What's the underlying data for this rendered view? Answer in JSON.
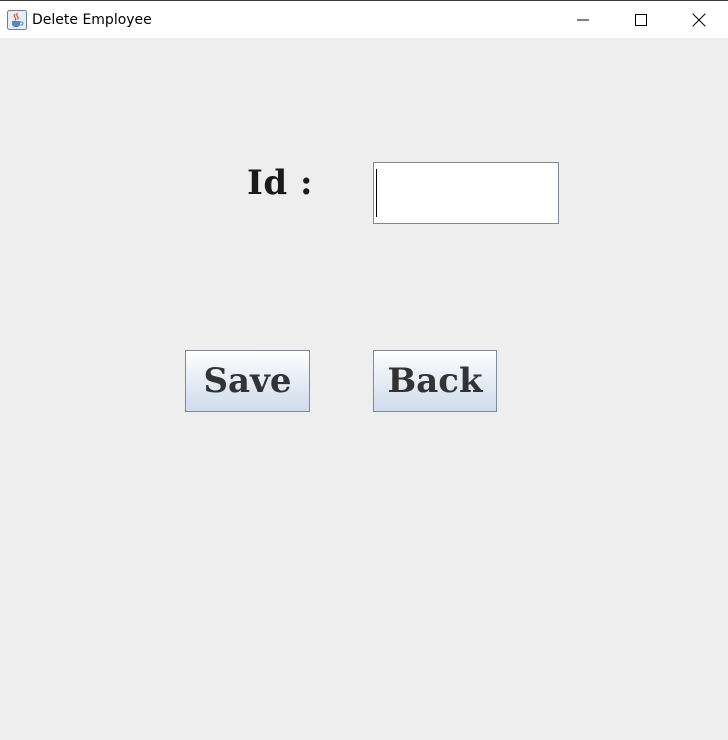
{
  "window": {
    "title": "Delete Employee",
    "icon": "java-cup-icon"
  },
  "form": {
    "id_label": "Id :",
    "id_value": "",
    "save_label": "Save",
    "back_label": "Back"
  },
  "colors": {
    "background": "#eeeeee",
    "button_border": "#7a8a9f",
    "button_gradient_bottom": "#cfdceb",
    "text": "#333333"
  }
}
